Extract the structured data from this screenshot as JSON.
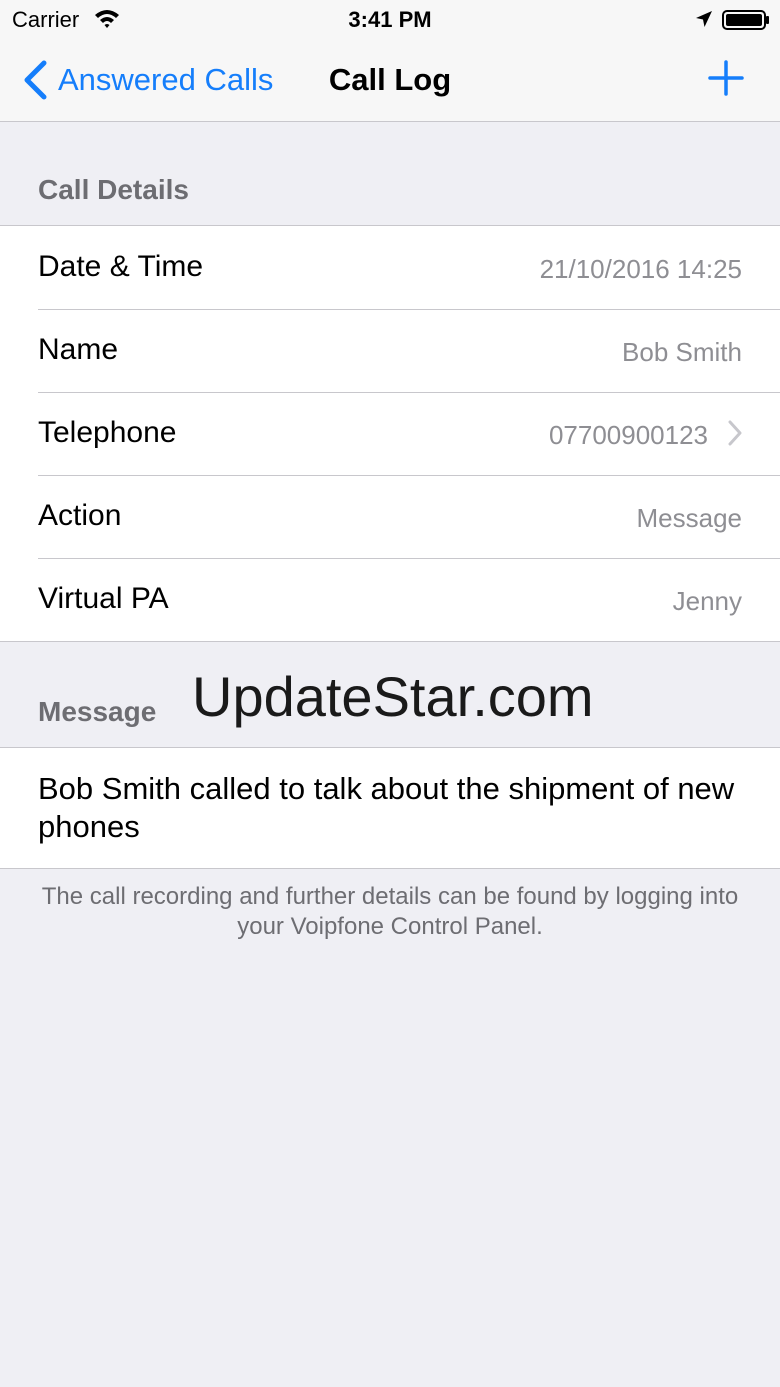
{
  "status_bar": {
    "carrier": "Carrier",
    "time": "3:41 PM",
    "icons": [
      "wifi-icon",
      "location-arrow-icon",
      "battery-icon"
    ]
  },
  "nav": {
    "back_label": "Answered Calls",
    "title": "Call Log",
    "add_icon": "plus-icon",
    "accent_color": "#157efb"
  },
  "call_details": {
    "header": "Call Details",
    "rows": [
      {
        "label": "Date & Time",
        "value": "21/10/2016 14:25"
      },
      {
        "label": "Name",
        "value": "Bob Smith"
      },
      {
        "label": "Telephone",
        "value": "07700900123"
      },
      {
        "label": "Action",
        "value": "Message"
      },
      {
        "label": "Virtual PA",
        "value": "Jenny"
      }
    ]
  },
  "message": {
    "header": "Message",
    "text": "Bob Smith called to talk about the shipment of new phones",
    "footer": "The call recording and further details can be found by logging into your Voipfone Control Panel."
  },
  "watermark": "UpdateStar.com"
}
